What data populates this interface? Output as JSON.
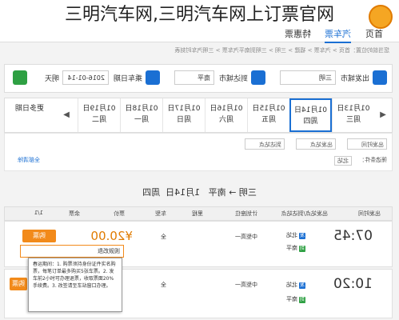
{
  "caption": "三明汽车网,三明汽车网上订票官网",
  "nav": {
    "links": [
      "首页",
      "汽车票",
      "特惠票"
    ]
  },
  "breadcrumb": "您当前的位置：首页 > 汽车票 > 福建 > 三明 > 三明到南平汽车票 > 三明汽车时刻表",
  "search": {
    "from_label": "出发城市",
    "from_value": "三明",
    "to_label": "到达城市",
    "to_value": "南平",
    "date_label": "乘车日期",
    "date_value": "2016-01-14",
    "date_suffix": "明天"
  },
  "dates": {
    "prev": "◀",
    "next": "▶",
    "more_label": "更多日期",
    "items": [
      {
        "date": "01月13日",
        "week": "周三"
      },
      {
        "date": "01月14日",
        "week": "周四",
        "selected": true
      },
      {
        "date": "01月15日",
        "week": "周五"
      },
      {
        "date": "01月16日",
        "week": "周六"
      },
      {
        "date": "01月17日",
        "week": "周日"
      },
      {
        "date": "01月18日",
        "week": "周一"
      },
      {
        "date": "01月19日",
        "week": "周二"
      }
    ]
  },
  "filters": {
    "time_select": "出发时间",
    "station_select": "出发站点",
    "arrive_select": "到达站点",
    "selected_label": "筛选条件：",
    "selected_tag": "北站",
    "clear": "全部清除"
  },
  "route": {
    "from": "三明",
    "to": "南平",
    "sep": "→",
    "date": "1月14日",
    "week": "周四"
  },
  "table": {
    "headers": [
      "出发时间",
      "出发站点/到达站点",
      "计划座位",
      "里程",
      "车型",
      "票价",
      "余票",
      "1/1"
    ],
    "rows": [
      {
        "time": "07:45",
        "from": "北站",
        "to": "南平",
        "plan": "中型高一",
        "type": "全",
        "price": "¥20.00",
        "btn": "购票"
      },
      {
        "time": "10:20",
        "from": "北站",
        "to": "南平",
        "plan": "中型高一",
        "type": "全",
        "price": "",
        "btn": "购票"
      }
    ]
  },
  "tooltip": {
    "title": "退改规则",
    "text": "春运期间：1. 购票须持身份证件实名购票，每笔订单最多购买5张车票。2. 发车前2小时可办理退票，收取票面20%手续费。3. 改签请至车站窗口办理。"
  },
  "colors": {
    "accent": "#1a6fd3",
    "orange": "#f28a1a",
    "green": "#2ea043"
  }
}
